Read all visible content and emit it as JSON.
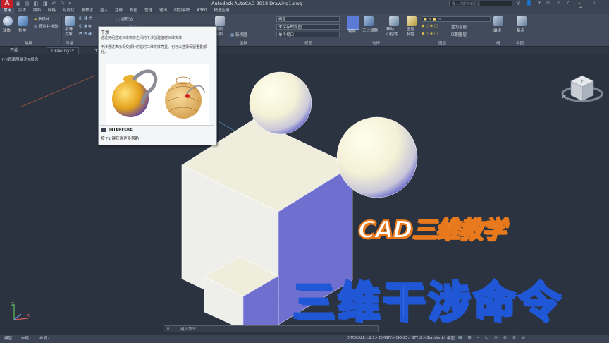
{
  "titlebar": {
    "app_logo": "A",
    "title": "Autodesk AutoCAD 2018    Drawing1.dwg",
    "search_placeholder": "键入关键字或短语",
    "window_controls": "– ☐ ✕"
  },
  "ribbon_tabs": [
    "常用",
    "实体",
    "曲面",
    "网格",
    "可视化",
    "参数化",
    "插入",
    "注释",
    "视图",
    "管理",
    "输出",
    "附加模块",
    "A360",
    "精选应用"
  ],
  "ribbon": {
    "buttons": {
      "sphere": "球体",
      "extrude": "拉伸",
      "multi_body": "多段体",
      "press_pull": "按住并拖动",
      "smooth_object": "平滑\n对象",
      "extract_edges": "提取边",
      "section_plane": "截面\n平面",
      "culling": "剔除",
      "move_gizmo": "移动\n小控件",
      "group": "编组",
      "layer_properties": "图层\n特性",
      "base_point": "基点",
      "no_filter": "无过滤器",
      "unsaved_view": "未保存的视图",
      "single_viewport": "单个视口",
      "match_layer": "置为当前",
      "match_layer2": "匹配图层",
      "unsaved_layer_state": "未保存的图层状态",
      "new_section": "新视图"
    },
    "combo_visual_style": "概念",
    "combo_layer": "0",
    "group_labels": [
      "建模",
      "网格",
      "坐标",
      "视图",
      "选择",
      "图层",
      "组",
      "视图"
    ]
  },
  "filetabs": {
    "start": "开始",
    "drawing": "Drawing1*",
    "add": "+"
  },
  "viewport": {
    "label": "[-][西南等轴测][概念]"
  },
  "tooltip": {
    "title": "干涉",
    "desc1": "通过两组选定三维实体之间的干涉创建临时三维实体",
    "desc2": "干涉通过表示相交部分的临时三维实体亮显。也可以选择保留重叠部分。",
    "command": "INTERFERE",
    "help": "按 F1 键获得更多帮助"
  },
  "viewcube": {
    "face": "上",
    "compass": "W"
  },
  "command_line": {
    "close_glyph": "✕",
    "prompt": "键入命令"
  },
  "status": {
    "tabs": [
      "模型",
      "布局1",
      "布局2"
    ],
    "text": "DIMSCALE:<1:1> DIMSTY:<ISO-25> STYLE:<Standard>",
    "model_label": "模型",
    "icons": "▦ ⊞ ⌖ ∟ ◎ ⊕ ⚙ ≡"
  },
  "overlay": {
    "line1": "CAD三维教学",
    "line2": "三维干涉命令"
  },
  "colors": {
    "background": "#2b3340",
    "ribbon": "#414b5b",
    "cube_top": "#efeedd",
    "cube_left": "#eeeeea",
    "cube_right": "#6f6fd0",
    "sphere_light": "#fbfadf",
    "accent_orange": "#e8791d",
    "accent_blue": "#1f57d6"
  }
}
